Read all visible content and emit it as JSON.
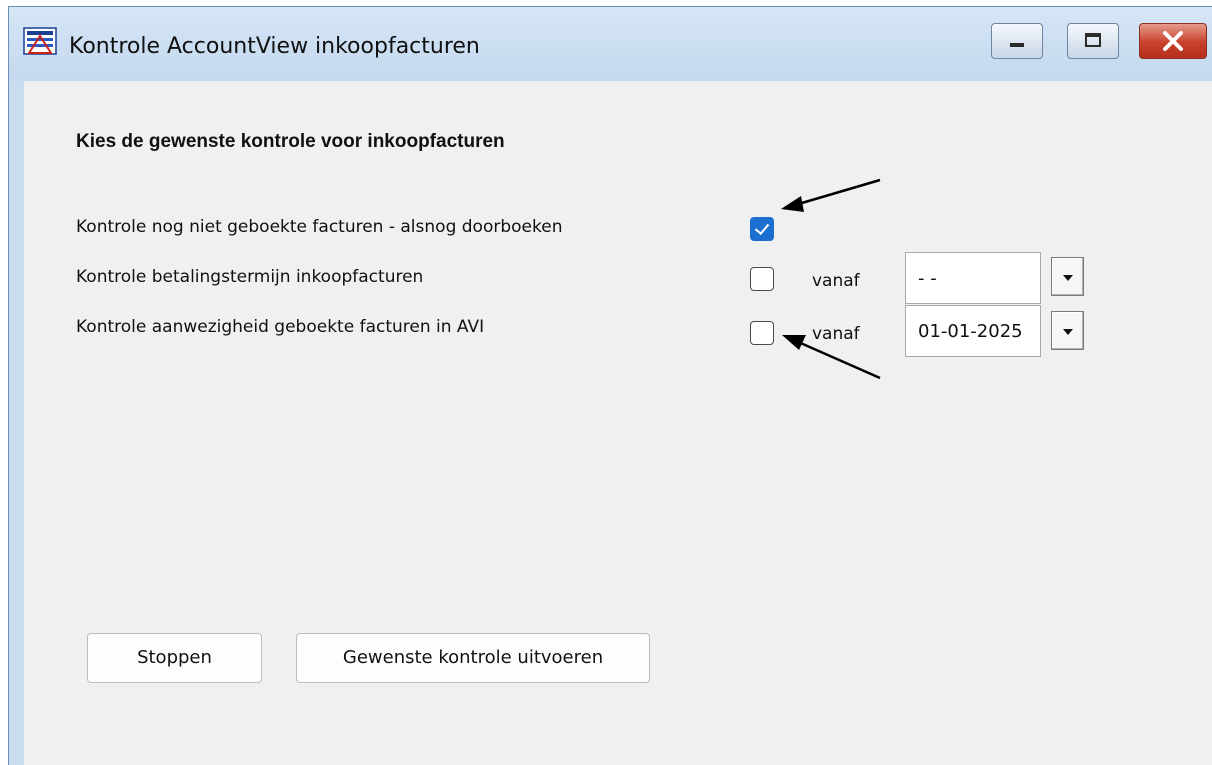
{
  "window": {
    "title": "Kontrole AccountView inkoopfacturen",
    "controls": [
      "minimize",
      "maximize",
      "close"
    ]
  },
  "form": {
    "heading": "Kies de gewenste kontrole voor inkoopfacturen",
    "options": [
      {
        "label": "Kontrole nog niet geboekte facturen - alsnog doorboeken",
        "checked": true
      },
      {
        "label": "Kontrole betalingstermijn inkoopfacturen",
        "checked": false,
        "from_label": "vanaf",
        "date_value": "- -"
      },
      {
        "label": "Kontrole aanwezigheid geboekte facturen in AVI",
        "checked": false,
        "from_label": "vanaf",
        "date_value": "01-01-2025"
      }
    ]
  },
  "buttons": {
    "stop_label": "Stoppen",
    "run_label": "Gewenste kontrole uitvoeren"
  },
  "colors": {
    "titlebar": "#c9dcf0",
    "client_bg": "#f0f0f0",
    "checkbox_checked": "#1a6fd1",
    "close_button": "#c7412b"
  },
  "icons": [
    "app-icon",
    "minimize-icon",
    "maximize-icon",
    "close-icon",
    "checkmark-icon",
    "dropdown-arrow-icon",
    "arrow-icon"
  ]
}
